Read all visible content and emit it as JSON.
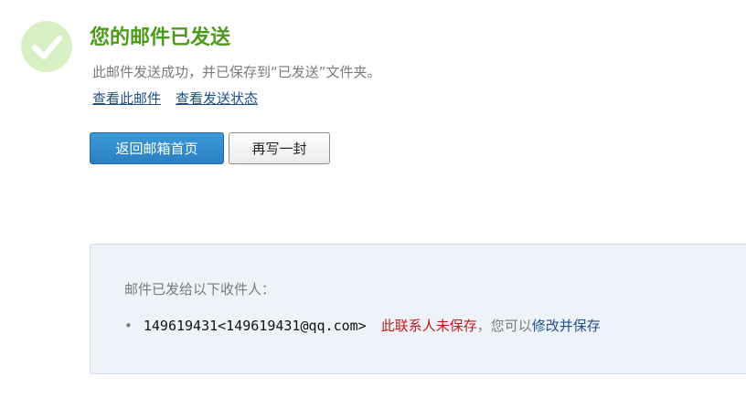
{
  "status": {
    "title": "您的邮件已发送",
    "subtitle": "此邮件发送成功，并已保存到“已发送”文件夹。",
    "icon": "checkmark-icon",
    "colors": {
      "title": "#4c9b1b",
      "icon_bg": "#d9f0c5",
      "icon_check": "#ffffff"
    }
  },
  "links": {
    "view_mail": "查看此邮件",
    "view_status": "查看发送状态"
  },
  "buttons": {
    "back_to_inbox": "返回邮箱首页",
    "write_another": "再写一封"
  },
  "recipients": {
    "heading": "邮件已发给以下收件人：",
    "items": [
      {
        "address": "149619431<149619431@qq.com>",
        "notice": "此联系人未保存",
        "separator": "，您可以",
        "action": "修改并保存"
      }
    ]
  }
}
